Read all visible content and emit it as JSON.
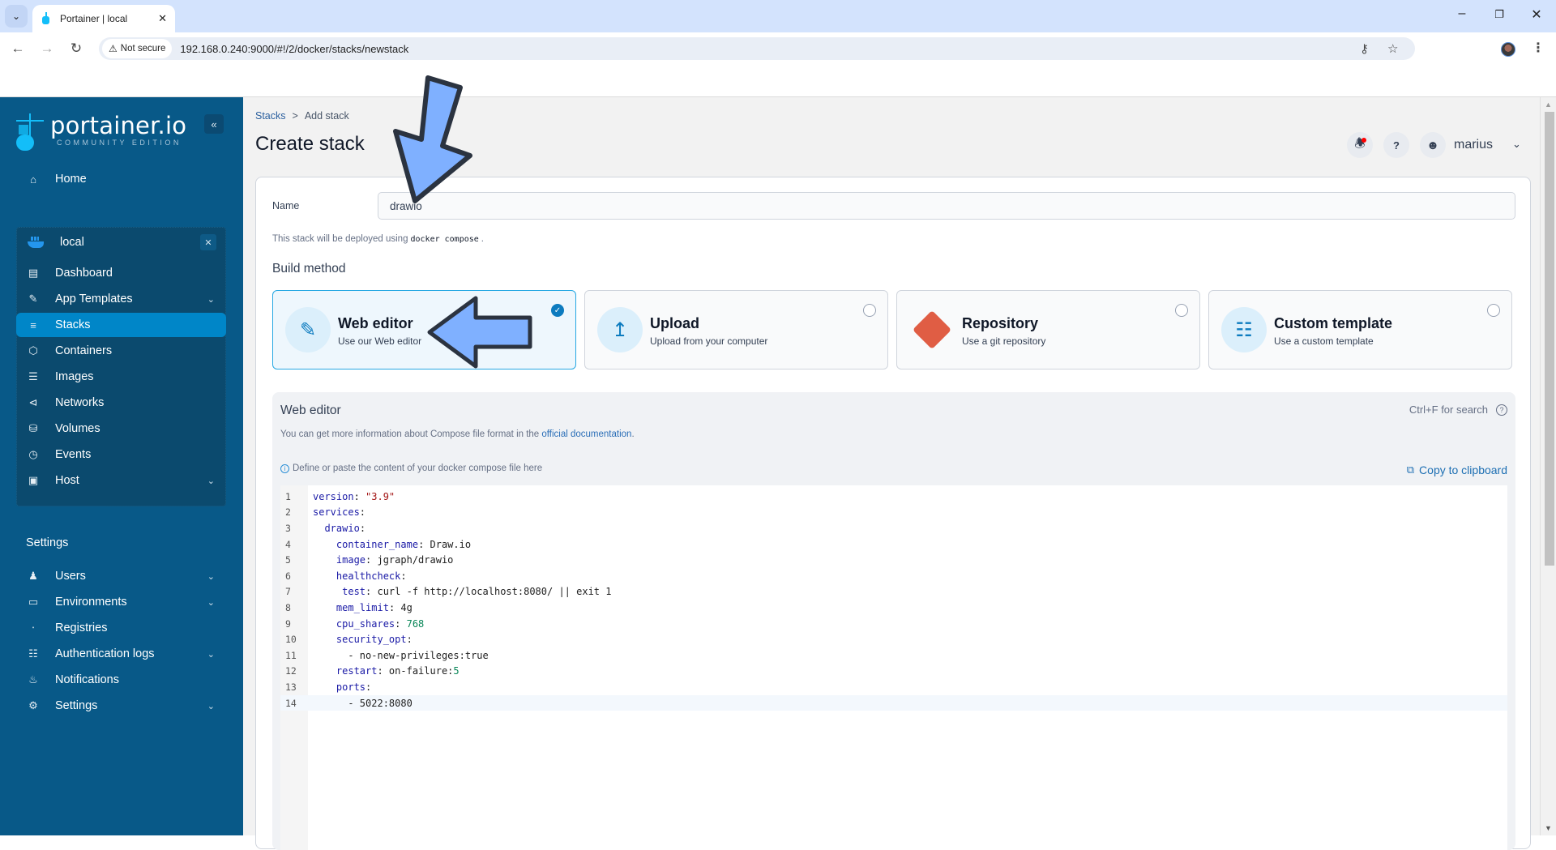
{
  "browser": {
    "tab_title": "Portainer | local",
    "security_label": "Not secure",
    "url": "192.168.0.240:9000/#!/2/docker/stacks/newstack",
    "icons": [
      "tab-search-icon",
      "back-icon",
      "forward-icon",
      "reload-icon",
      "password-key-icon",
      "bookmark-star-icon",
      "profile-avatar",
      "more-menu-icon",
      "minimize-icon",
      "restore-icon",
      "close-icon"
    ]
  },
  "sidebar": {
    "logo": "portainer.io",
    "logo_sub": "COMMUNITY EDITION",
    "home": "Home",
    "environment": {
      "name": "local",
      "items": [
        {
          "label": "Dashboard",
          "icon": "dashboard-icon",
          "chevron": false,
          "active": false
        },
        {
          "label": "App Templates",
          "icon": "edit-icon",
          "chevron": true,
          "active": false
        },
        {
          "label": "Stacks",
          "icon": "layers-icon",
          "chevron": false,
          "active": true
        },
        {
          "label": "Containers",
          "icon": "box-icon",
          "chevron": false,
          "active": false
        },
        {
          "label": "Images",
          "icon": "list-icon",
          "chevron": false,
          "active": false
        },
        {
          "label": "Networks",
          "icon": "share-icon",
          "chevron": false,
          "active": false
        },
        {
          "label": "Volumes",
          "icon": "database-icon",
          "chevron": false,
          "active": false
        },
        {
          "label": "Events",
          "icon": "clock-icon",
          "chevron": false,
          "active": false
        },
        {
          "label": "Host",
          "icon": "host-icon",
          "chevron": true,
          "active": false
        }
      ]
    },
    "settings_heading": "Settings",
    "settings_items": [
      {
        "label": "Users",
        "icon": "users-icon",
        "chevron": true
      },
      {
        "label": "Environments",
        "icon": "hard-drive-icon",
        "chevron": true
      },
      {
        "label": "Registries",
        "icon": "radio-icon",
        "chevron": false
      },
      {
        "label": "Authentication logs",
        "icon": "file-text-icon",
        "chevron": true
      },
      {
        "label": "Notifications",
        "icon": "bell-icon",
        "chevron": false
      },
      {
        "label": "Settings",
        "icon": "gear-icon",
        "chevron": true
      }
    ]
  },
  "header": {
    "breadcrumb": {
      "parent": "Stacks",
      "separator": ">",
      "current": "Add stack"
    },
    "title": "Create stack",
    "user": "marius"
  },
  "form": {
    "name_label": "Name",
    "name_value": "drawio",
    "deploy_note_prefix": "This stack will be deployed using",
    "deploy_note_code": "docker compose",
    "deploy_note_suffix": ".",
    "build_method_title": "Build method",
    "methods": [
      {
        "title": "Web editor",
        "subtitle": "Use our Web editor",
        "selected": true
      },
      {
        "title": "Upload",
        "subtitle": "Upload from your computer",
        "selected": false
      },
      {
        "title": "Repository",
        "subtitle": "Use a git repository",
        "selected": false
      },
      {
        "title": "Custom template",
        "subtitle": "Use a custom template",
        "selected": false
      }
    ]
  },
  "editor": {
    "title": "Web editor",
    "search_hint": "Ctrl+F for search",
    "info_prefix": "You can get more information about Compose file format in the",
    "info_link": "official documentation",
    "info_suffix": ".",
    "hint": "Define or paste the content of your docker compose file here",
    "copy_label": "Copy to clipboard",
    "active_line": 14,
    "lines": [
      "version: \"3.9\"",
      "services:",
      "  drawio:",
      "    container_name: Draw.io",
      "    image: jgraph/drawio",
      "    healthcheck:",
      "     test: curl -f http://localhost:8080/ || exit 1",
      "    mem_limit: 4g",
      "    cpu_shares: 768",
      "    security_opt:",
      "      - no-new-privileges:true",
      "    restart: on-failure:5",
      "    ports:",
      "      - 5022:8080"
    ]
  },
  "colors": {
    "sidebar_bg": "#085988",
    "sidebar_active": "#0086c8",
    "accent": "#0c7bbf",
    "annotation_arrow": "#7fb0ff"
  }
}
